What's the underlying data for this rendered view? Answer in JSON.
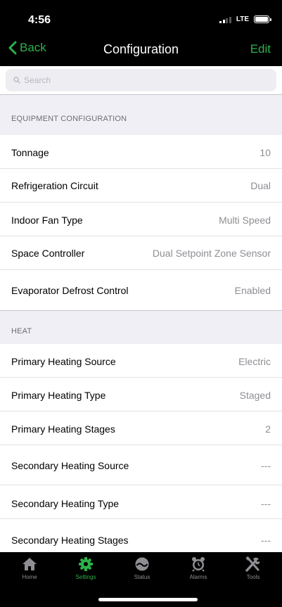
{
  "status_bar": {
    "time": "4:56",
    "network": "LTE"
  },
  "nav": {
    "back_label": "Back",
    "title": "Configuration",
    "edit_label": "Edit"
  },
  "search": {
    "placeholder": "Search"
  },
  "sections": [
    {
      "header": "EQUIPMENT CONFIGURATION",
      "rows": [
        {
          "label": "Tonnage",
          "value": "10"
        },
        {
          "label": "Refrigeration Circuit",
          "value": "Dual"
        },
        {
          "label": "Indoor Fan Type",
          "value": "Multi Speed"
        },
        {
          "label": "Space Controller",
          "value": "Dual Setpoint Zone Sensor"
        },
        {
          "label": "Evaporator Defrost Control",
          "value": "Enabled"
        }
      ]
    },
    {
      "header": "HEAT",
      "rows": [
        {
          "label": "Primary Heating Source",
          "value": "Electric"
        },
        {
          "label": "Primary Heating Type",
          "value": "Staged"
        },
        {
          "label": "Primary Heating Stages",
          "value": "2"
        },
        {
          "label": "Secondary Heating Source",
          "value": "---"
        },
        {
          "label": "Secondary Heating Type",
          "value": "---"
        },
        {
          "label": "Secondary Heating Stages",
          "value": "---"
        }
      ]
    }
  ],
  "tabs": [
    {
      "label": "Home",
      "icon": "home-icon",
      "active": false
    },
    {
      "label": "Settings",
      "icon": "gear-icon",
      "active": true
    },
    {
      "label": "Status",
      "icon": "gauge-icon",
      "active": false
    },
    {
      "label": "Alarms",
      "icon": "alarm-clock-icon",
      "active": false
    },
    {
      "label": "Tools",
      "icon": "tools-icon",
      "active": false
    }
  ],
  "colors": {
    "accent": "#2db14a",
    "bar_background": "#000000",
    "group_background": "#f0eff5"
  }
}
